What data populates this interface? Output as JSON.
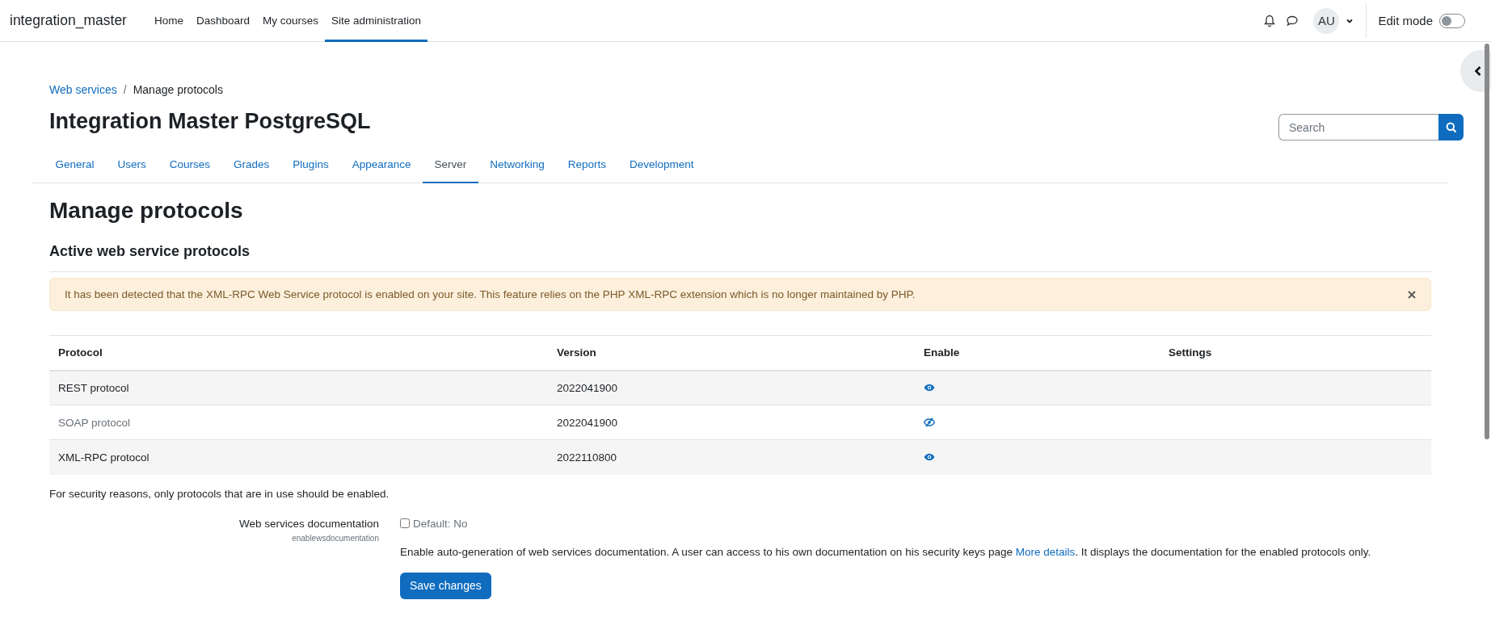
{
  "navbar": {
    "site_name": "integration_master",
    "items": [
      {
        "label": "Home",
        "selected": false
      },
      {
        "label": "Dashboard",
        "selected": false
      },
      {
        "label": "My courses",
        "selected": false
      },
      {
        "label": "Site administration",
        "selected": true
      }
    ],
    "avatar": "AU",
    "edit_mode": {
      "label": "Edit mode",
      "on": false
    }
  },
  "breadcrumb": {
    "separator": "/",
    "items": [
      {
        "label": "Web services",
        "link": true
      },
      {
        "label": "Manage protocols",
        "link": false
      }
    ]
  },
  "page_title": "Integration Master PostgreSQL",
  "search": {
    "placeholder": "Search"
  },
  "tabs": [
    {
      "label": "General",
      "selected": false
    },
    {
      "label": "Users",
      "selected": false
    },
    {
      "label": "Courses",
      "selected": false
    },
    {
      "label": "Grades",
      "selected": false
    },
    {
      "label": "Plugins",
      "selected": false
    },
    {
      "label": "Appearance",
      "selected": false
    },
    {
      "label": "Server",
      "selected": true
    },
    {
      "label": "Networking",
      "selected": false
    },
    {
      "label": "Reports",
      "selected": false
    },
    {
      "label": "Development",
      "selected": false
    }
  ],
  "heading": "Manage protocols",
  "subheading": "Active web service protocols",
  "alert": "It has been detected that the XML-RPC Web Service protocol is enabled on your site. This feature relies on the PHP XML-RPC extension which is no longer maintained by PHP.",
  "table": {
    "columns": [
      "Protocol",
      "Version",
      "Enable",
      "Settings"
    ],
    "rows": [
      {
        "protocol": "REST protocol",
        "version": "2022041900",
        "enabled": true
      },
      {
        "protocol": "SOAP protocol",
        "version": "2022041900",
        "enabled": false
      },
      {
        "protocol": "XML-RPC protocol",
        "version": "2022110800",
        "enabled": true
      }
    ]
  },
  "note": "For security reasons, only protocols that are in use should be enabled.",
  "setting": {
    "label": "Web services documentation",
    "name": "enablewsdocumentation",
    "checked": false,
    "default": "Default: No",
    "description_before": "Enable auto-generation of web services documentation. A user can access to his own documentation on his security keys page ",
    "link": "More details",
    "description_after": ". It displays the documentation for the enabled protocols only."
  },
  "save_button": "Save changes"
}
